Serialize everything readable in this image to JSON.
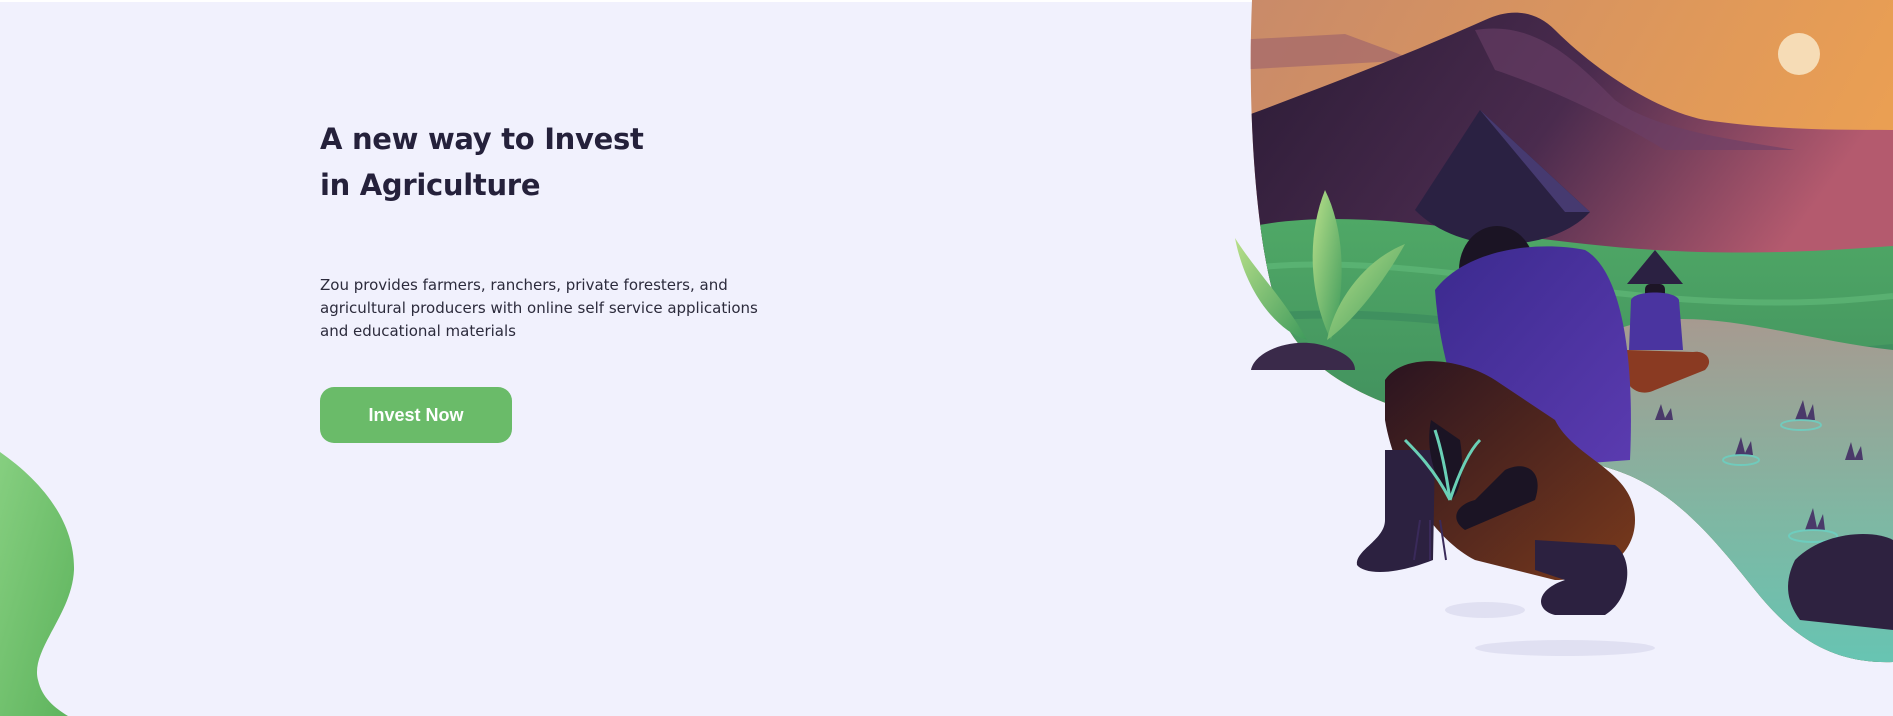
{
  "hero": {
    "headline_line1": "A new way to Invest",
    "headline_line2": "in Agriculture",
    "description": "Zou provides farmers, ranchers, private foresters, and agricultural producers with online self service applications and educational materials",
    "cta_label": "Invest Now"
  },
  "colors": {
    "background": "#f1f1fd",
    "headline": "#25213b",
    "body_text": "#2c2b3c",
    "button": "#6abb69",
    "button_text": "#ffffff",
    "green_accent": "#6fc06e"
  },
  "illustration": {
    "subject": "farmers-planting-rice-illustration"
  }
}
